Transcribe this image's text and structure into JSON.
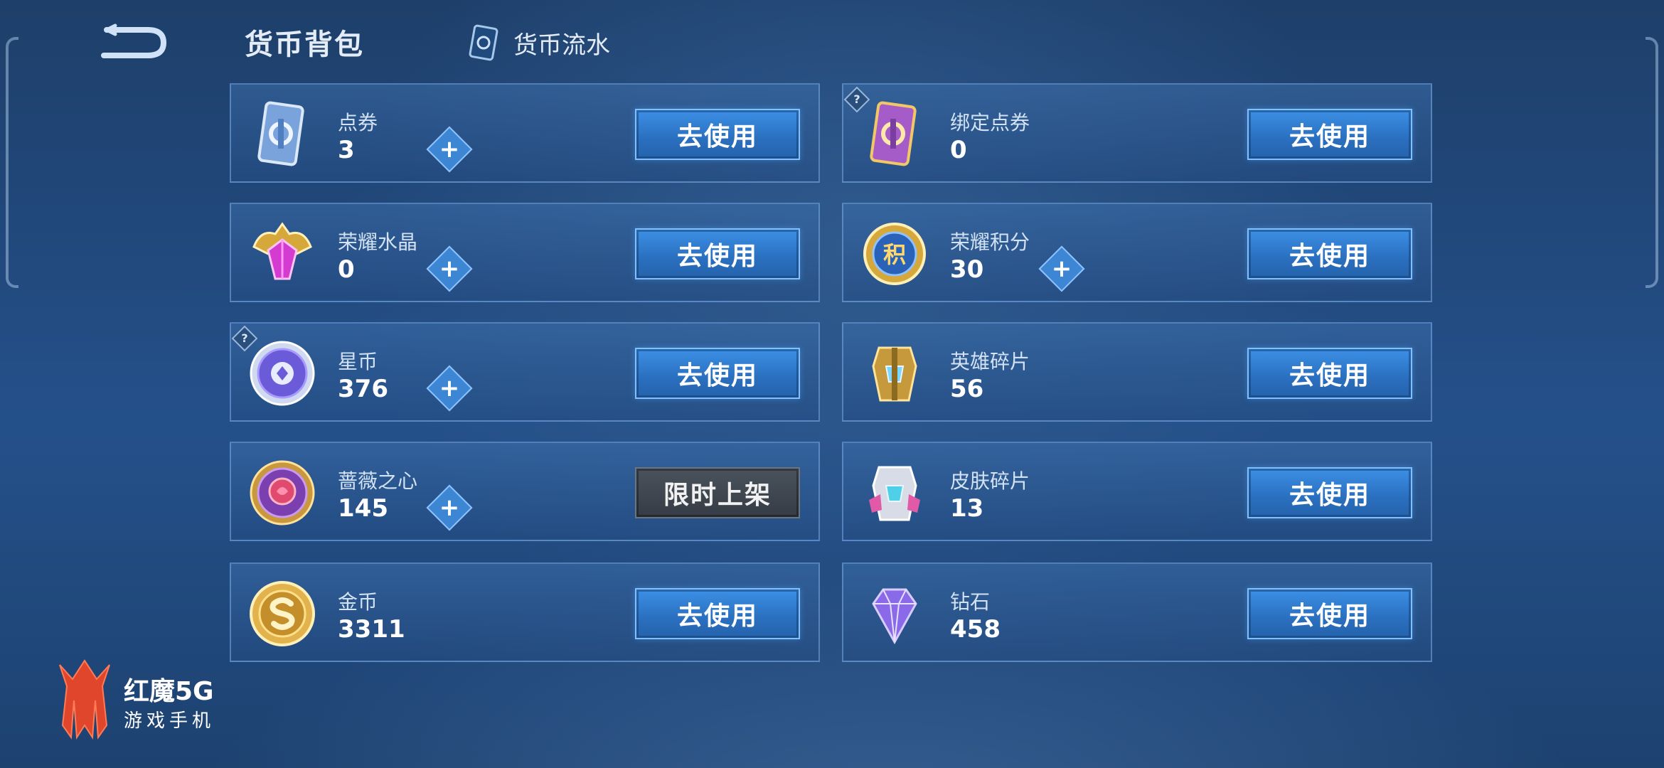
{
  "header": {
    "title": "货币背包",
    "flow_label": "货币流水"
  },
  "cards": [
    {
      "name": "点券",
      "value": "3",
      "action": "去使用",
      "icon": "ticket-icon",
      "plus": true,
      "help": false
    },
    {
      "name": "绑定点券",
      "value": "0",
      "action": "去使用",
      "icon": "bound-ticket-icon",
      "plus": false,
      "help": true
    },
    {
      "name": "荣耀水晶",
      "value": "0",
      "action": "去使用",
      "icon": "glory-crystal-icon",
      "plus": true,
      "help": false
    },
    {
      "name": "荣耀积分",
      "value": "30",
      "action": "去使用",
      "icon": "glory-points-icon",
      "plus": true,
      "help": false
    },
    {
      "name": "星币",
      "value": "376",
      "action": "去使用",
      "icon": "star-coin-icon",
      "plus": true,
      "help": true
    },
    {
      "name": "英雄碎片",
      "value": "56",
      "action": "去使用",
      "icon": "hero-fragment-icon",
      "plus": false,
      "help": false
    },
    {
      "name": "蔷薇之心",
      "value": "145",
      "action": "限时上架",
      "icon": "rose-heart-icon",
      "plus": true,
      "help": false
    },
    {
      "name": "皮肤碎片",
      "value": "13",
      "action": "去使用",
      "icon": "skin-fragment-icon",
      "plus": false,
      "help": false
    },
    {
      "name": "金币",
      "value": "3311",
      "action": "去使用",
      "icon": "gold-coin-icon",
      "plus": false,
      "help": false
    },
    {
      "name": "钻石",
      "value": "458",
      "action": "去使用",
      "icon": "diamond-icon",
      "plus": false,
      "help": false
    }
  ],
  "plus_glyph": "+",
  "help_glyph": "?",
  "points_glyph": "积",
  "brand": {
    "name": "红魔5G",
    "tagline": "游戏手机"
  },
  "colors": {
    "accent": "#3c90e6",
    "disabled": "#4a525c"
  }
}
